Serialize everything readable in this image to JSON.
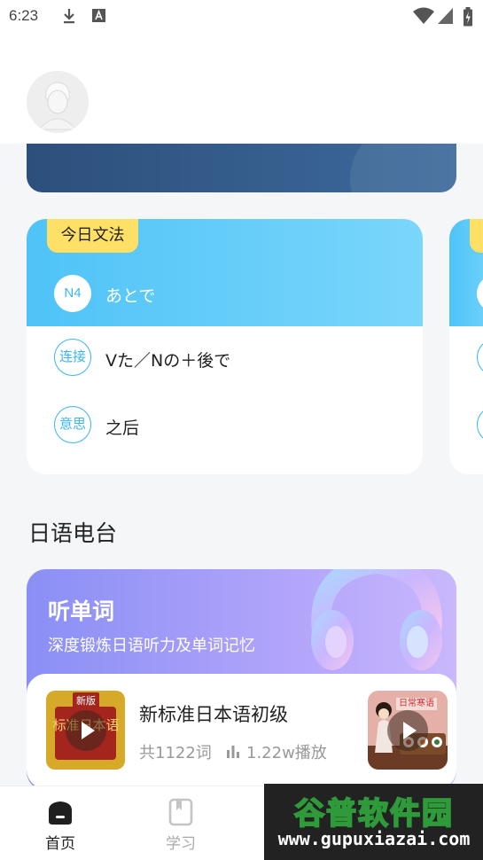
{
  "status_bar": {
    "time": "6:23",
    "left_icons": [
      "download-icon",
      "a-square-icon"
    ],
    "right_icons": [
      "wifi-icon",
      "signal-icon",
      "battery-icon"
    ]
  },
  "profile": {
    "avatar_icon": "user-avatar-icon"
  },
  "grammar_card": {
    "tag": "今日文法",
    "level": "N4",
    "title": "あとで",
    "rows": [
      {
        "label": "连接",
        "text": "Vた／Nの＋後で"
      },
      {
        "label": "意思",
        "text": "之后"
      }
    ],
    "accent": "#4fc3f7",
    "tag_color": "#ffe066"
  },
  "radio": {
    "section_title": "日语电台",
    "card_title": "听单词",
    "card_subtitle": "深度锻炼日语听力及单词记忆",
    "card_color": "#9a98f7",
    "items": [
      {
        "title": "新标准日本语初级",
        "count": "共1122词",
        "plays": "1.22w播放",
        "cover_badge": "新版",
        "cover_text": "标准日本语"
      },
      {
        "cover_text": "日常寒语"
      }
    ]
  },
  "tabs": [
    {
      "label": "首页",
      "icon": "home-icon",
      "active": true
    },
    {
      "label": "学习",
      "icon": "book-icon",
      "active": false
    }
  ],
  "watermark": {
    "title": "谷普软件园",
    "url": "www.gupuxiazai.com"
  }
}
